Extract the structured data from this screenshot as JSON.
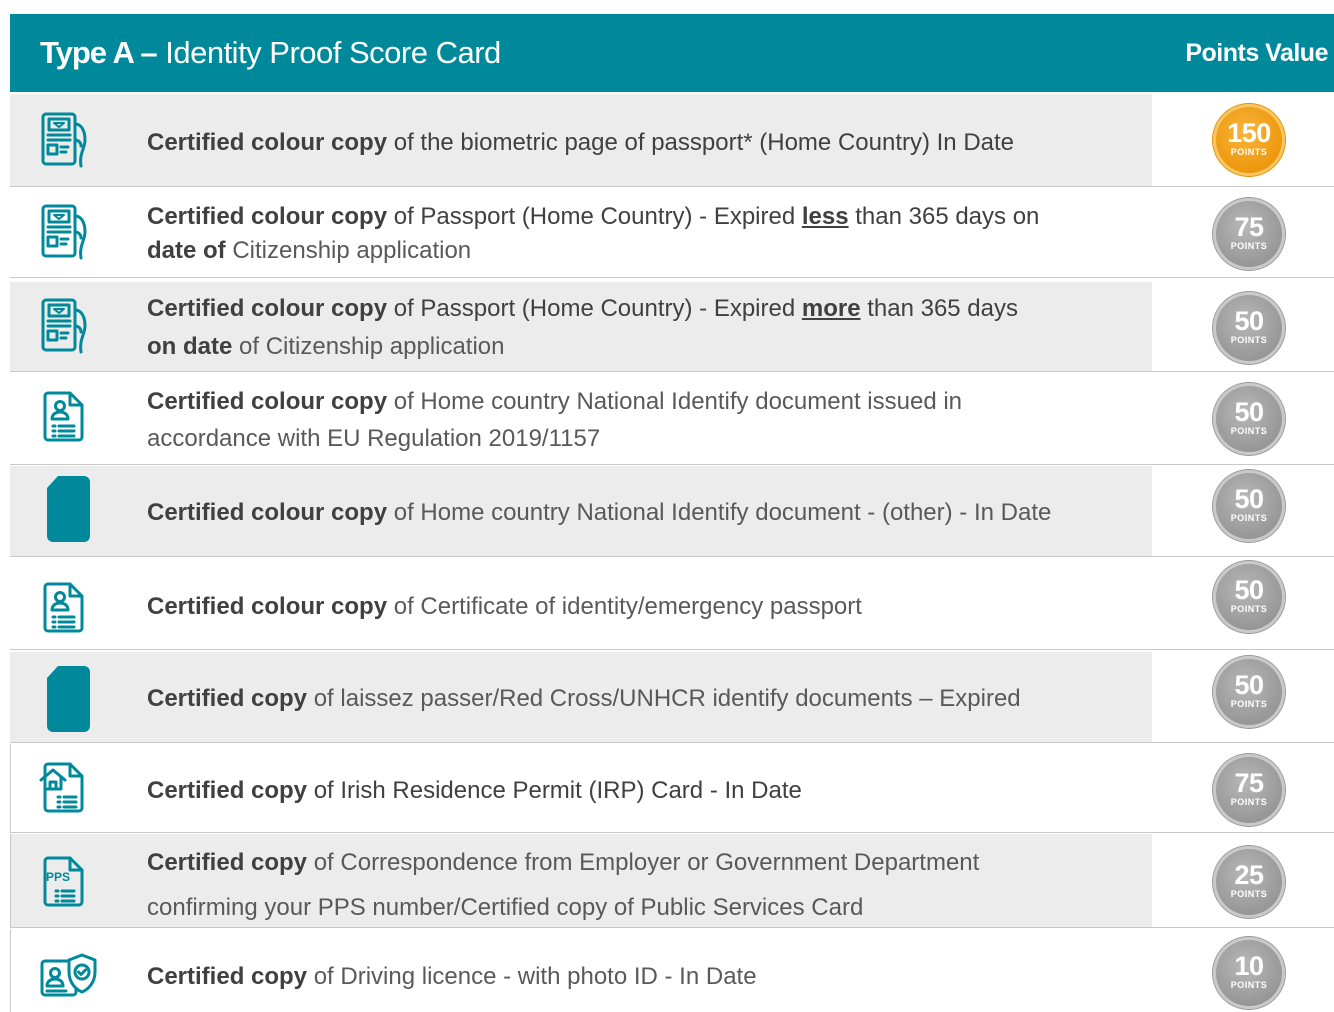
{
  "header": {
    "title_strong": "Type A –",
    "title_rest": "Identity Proof Score Card",
    "points_heading": "Points Value"
  },
  "badge_label": "POINTS",
  "rows": [
    {
      "icon": "passport-hand-icon",
      "strong": "Certified colour copy",
      "rest": " of the biometric page of passport* (Home Country) In Date",
      "points": "150"
    },
    {
      "icon": "passport-hand-icon",
      "strong": "Certified colour copy",
      "part1": " of Passport (Home Country) - Expired ",
      "emph": "less",
      "part2": " than 365 days on",
      "line2_strong": "date of",
      "line2_rest": " Citizenship application",
      "points": "75"
    },
    {
      "icon": "passport-hand-icon",
      "strong": "Certified colour copy",
      "part1": " of Passport (Home Country) - Expired ",
      "emph": "more",
      "part2": " than 365 days",
      "line2_strong": "on date",
      "line2_rest": " of Citizenship application",
      "points": "50"
    },
    {
      "icon": "id-document-icon",
      "strong": "Certified colour copy",
      "part1": " of Home country National Identify document issued in",
      "line2_rest": "accordance with EU Regulation 2019/1157",
      "points": "50"
    },
    {
      "icon": "document-icon",
      "strong": "Certified  colour  copy",
      "rest": "  of Home country National Identify document  - (other) - In Date",
      "points": "50"
    },
    {
      "icon": "id-document-icon",
      "strong": "Certified  colour  copy",
      "rest": "  of Certificate  of identity/emergency  passport",
      "points": "50"
    },
    {
      "icon": "document-icon",
      "strong": "Certified copy",
      "rest": " of laissez passer/Red Cross/UNHCR identify documents  – Expired",
      "points": "50"
    },
    {
      "icon": "residence-permit-icon",
      "strong": "Certified copy",
      "rest_dark": " of Irish Residence Permit (IRP) Card - In Date",
      "points": "75"
    },
    {
      "icon": "pps-document-icon",
      "pps_text": "PPS",
      "strong": "Certified copy",
      "part1": " of Correspondence from Employer or Government Department",
      "line2_rest": "confirming your PPS number/Certified copy of Public Services Card",
      "points": "25"
    },
    {
      "icon": "driving-licence-shield-icon",
      "strong": "Certified copy",
      "rest": " of Driving licence - with photo ID - In Date",
      "points": "10"
    }
  ]
}
